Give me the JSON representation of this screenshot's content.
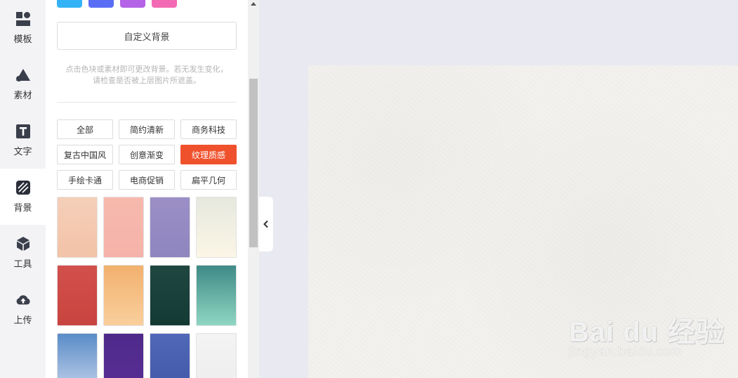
{
  "sidebar": {
    "items": [
      {
        "label": "模板",
        "icon": "template-icon"
      },
      {
        "label": "素材",
        "icon": "shapes-icon"
      },
      {
        "label": "文字",
        "icon": "text-icon"
      },
      {
        "label": "背景",
        "icon": "background-icon"
      },
      {
        "label": "工具",
        "icon": "cube-icon"
      },
      {
        "label": "上传",
        "icon": "cloud-upload-icon"
      }
    ],
    "active_index": 3
  },
  "panel": {
    "color_swatches": [
      "#33b3f5",
      "#5a6ef5",
      "#b463e6",
      "#f36ab4"
    ],
    "custom_bg_label": "自定义背景",
    "hint_line1": "点击色块或素材即可更改背景。若无发生变化，",
    "hint_line2": "请检查是否被上层图片所遮盖。",
    "categories": [
      "全部",
      "简约清新",
      "商务科技",
      "复古中国风",
      "创意渐变",
      "纹理质感",
      "手绘卡通",
      "电商促销",
      "扁平几何"
    ],
    "active_category_index": 5,
    "thumbnails": [
      {
        "gradient": [
          "#f5cfb9",
          "#f2c3a7"
        ]
      },
      {
        "gradient": [
          "#f7b9ad",
          "#f5b2aa"
        ]
      },
      {
        "gradient": [
          "#9b8fc6",
          "#8f85bf"
        ]
      },
      {
        "gradient": [
          "#e6e8de",
          "#fbf6e6"
        ]
      },
      {
        "gradient": [
          "#d2504b",
          "#c8443f"
        ]
      },
      {
        "gradient": [
          "#f2b16e",
          "#f9cf9c"
        ]
      },
      {
        "gradient": [
          "#1f4740",
          "#143a34"
        ]
      },
      {
        "gradient": [
          "#3f8a87",
          "#8fd6c2"
        ]
      },
      {
        "gradient": [
          "#5a8cc7",
          "#c5d4ec"
        ]
      },
      {
        "gradient": [
          "#4e2a8a",
          "#5b2d96"
        ]
      },
      {
        "gradient": [
          "#5068b8",
          "#4157a8"
        ]
      },
      {
        "gradient": [
          "#f4f3f3",
          "#eeeded"
        ]
      }
    ]
  },
  "colors": {
    "accent": "#f0512d",
    "canvas_bg": "#e9e9f1",
    "paper": "#f3f2ef"
  },
  "watermark": {
    "logo_text": "Bai du 经验",
    "url": "jingyan.baidu.com"
  }
}
